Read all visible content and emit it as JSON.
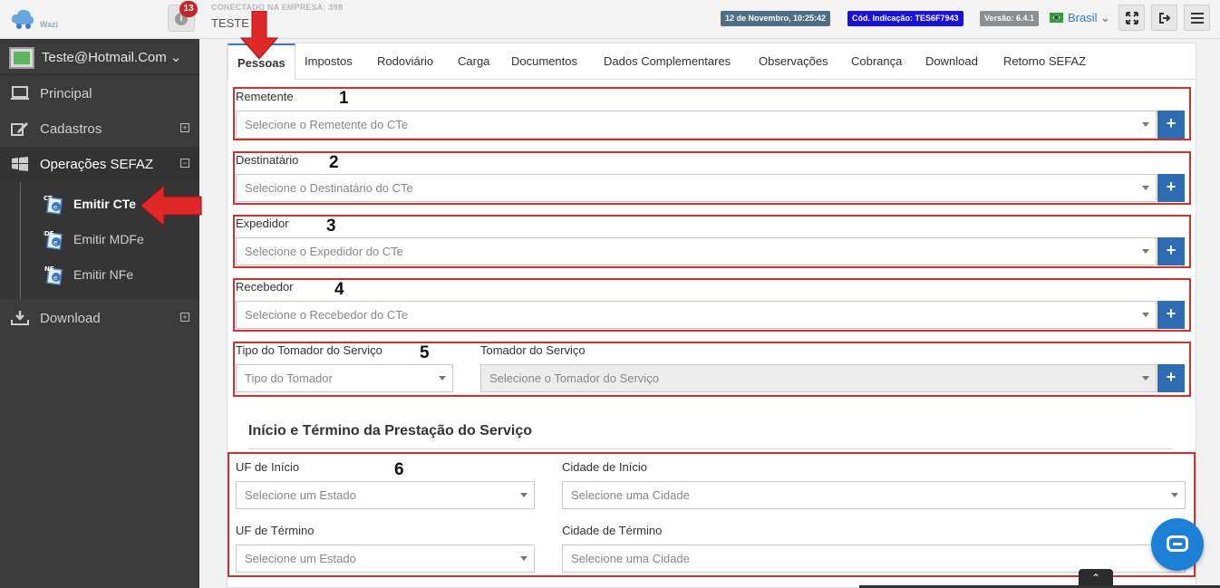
{
  "topbar": {
    "logo_text": "Wazi",
    "notification_count": "13",
    "company_label": "CONECTADO NA EMPRESA: 398",
    "company_name": "TESTE",
    "date_badge": "12 de Novembro, 10:25:42",
    "indication_badge": "Cód. Indicação: TES6F7943",
    "version_badge": "Versão: 6.4.1",
    "language": "Brasil",
    "icons": [
      "fullscreen-icon",
      "logout-icon",
      "menu-icon"
    ]
  },
  "sidebar": {
    "user": "Teste@Hotmail.Com",
    "items": [
      {
        "label": "Principal",
        "icon": "monitor-icon"
      },
      {
        "label": "Cadastros",
        "icon": "edit-icon"
      },
      {
        "label": "Operações SEFAZ",
        "icon": "windows-icon"
      },
      {
        "label": "Download",
        "icon": "download-icon"
      }
    ],
    "submenu": [
      {
        "label": "Emitir CTe",
        "tag": "CT"
      },
      {
        "label": "Emitir MDFe",
        "tag": "MDF"
      },
      {
        "label": "Emitir NFe",
        "tag": "NF"
      }
    ]
  },
  "tabs": [
    "Pessoas",
    "Impostos",
    "Rodoviário",
    "Carga",
    "Documentos",
    "Dados Complementares",
    "Observações",
    "Cobrança",
    "Download",
    "Retorno SEFAZ"
  ],
  "form": {
    "remetente": {
      "label": "Remetente",
      "placeholder": "Selecione o Remetente do CTe",
      "num": "1"
    },
    "destinatario": {
      "label": "Destinatário",
      "placeholder": "Selecione o Destinatário do CTe",
      "num": "2"
    },
    "expedidor": {
      "label": "Expedidor",
      "placeholder": "Selecione o Expedidor do CTe",
      "num": "3"
    },
    "recebedor": {
      "label": "Recebedor",
      "placeholder": "Selecione o Recebedor do CTe",
      "num": "4"
    },
    "tipo_tomador": {
      "label": "Tipo do Tomador do Serviço",
      "placeholder": "Tipo do Tomador",
      "num": "5"
    },
    "tomador": {
      "label": "Tomador do Serviço",
      "placeholder": "Selecione o Tomador do Serviço"
    },
    "add_label": "+"
  },
  "prestacao": {
    "title": "Início e Término da Prestação do Serviço",
    "num": "6",
    "uf_inicio": {
      "label": "UF de Início",
      "placeholder": "Selecione um Estado"
    },
    "cidade_inicio": {
      "label": "Cidade de Início",
      "placeholder": "Selecione uma Cidade"
    },
    "uf_termino": {
      "label": "UF de Término",
      "placeholder": "Selecione um Estado"
    },
    "cidade_termino": {
      "label": "Cidade de Término",
      "placeholder": "Selecione uma Cidade"
    }
  },
  "colors": {
    "highlight": "#d32f2f",
    "primary": "#2f6db3",
    "sidebar": "#3b3b3b"
  }
}
